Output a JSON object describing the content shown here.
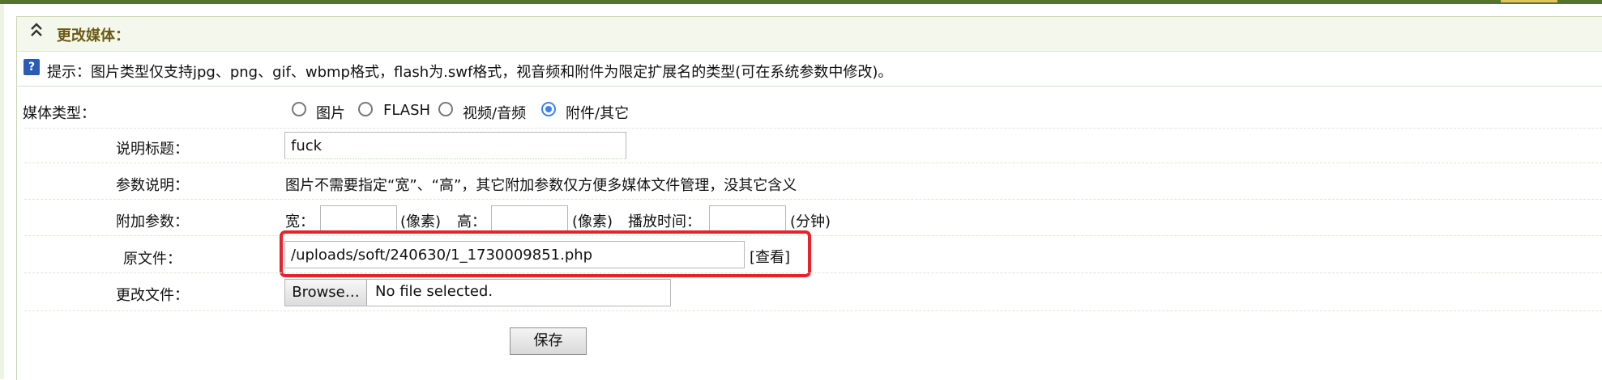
{
  "header": {
    "title": "更改媒体：",
    "icon": "double-chevron-up-icon"
  },
  "tip": {
    "icon": "help-icon",
    "icon_text": "?",
    "text": "提示：图片类型仅支持jpg、png、gif、wbmp格式，flash为.swf格式，视音频和附件为限定扩展名的类型(可在系统参数中修改)。"
  },
  "form": {
    "media_type": {
      "label": "媒体类型：",
      "options": [
        {
          "label": "图片",
          "checked": false
        },
        {
          "label": "FLASH",
          "checked": false
        },
        {
          "label": "视频/音频",
          "checked": false
        },
        {
          "label": "附件/其它",
          "checked": true
        }
      ]
    },
    "title": {
      "label": "说明标题：",
      "value": "fuck"
    },
    "param_desc": {
      "label": "参数说明：",
      "text": "图片不需要指定“宽”、“高”，其它附加参数仅方便多媒体文件管理，没其它含义"
    },
    "extra_params": {
      "label": "附加参数：",
      "width_label": "宽：",
      "width_value": "",
      "width_unit": "(像素)",
      "height_label": "高：",
      "height_value": "",
      "height_unit": "(像素)",
      "duration_label": "播放时间：",
      "duration_value": "",
      "duration_unit": "(分钟)"
    },
    "original_file": {
      "label": "原文件：",
      "value": "/uploads/soft/240630/1_1730009851.php",
      "view_link": "[查看]"
    },
    "change_file": {
      "label": "更改文件：",
      "browse_label": "Browse…",
      "status": "No file selected."
    },
    "save_label": "保存"
  },
  "colors": {
    "highlight": "#e6232a",
    "header_title": "#6b5a12",
    "top_bar": "#53742a",
    "radio_checked": "#3b82f6"
  }
}
